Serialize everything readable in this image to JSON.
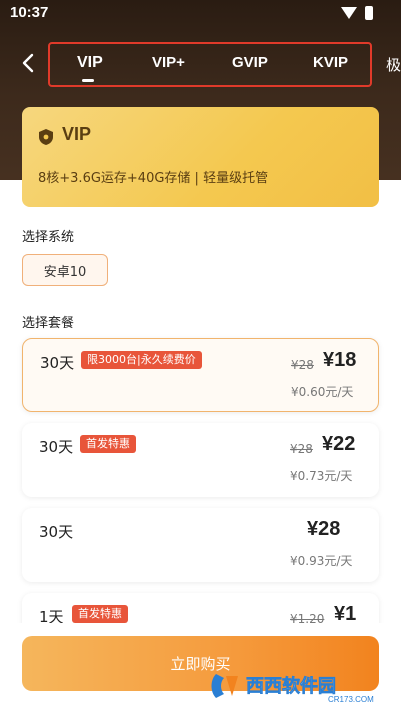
{
  "status_bar": {
    "time": "10:37"
  },
  "tabs": [
    {
      "label": "VIP",
      "active": true
    },
    {
      "label": "VIP+"
    },
    {
      "label": "GVIP"
    },
    {
      "label": "KVIP"
    },
    {
      "label": "极"
    }
  ],
  "vip_card": {
    "title": "VIP",
    "description": "8核+3.6G运存+40G存储 | 轻量级托管"
  },
  "system_section": {
    "label": "选择系统",
    "option": "安卓10"
  },
  "plan_section": {
    "label": "选择套餐"
  },
  "plans": [
    {
      "duration": "30天",
      "badge": "限3000台|永久续费价",
      "original_price": "¥28",
      "price": "¥18",
      "daily": "¥0.60元/天",
      "selected": true
    },
    {
      "duration": "30天",
      "badge": "首发特惠",
      "original_price": "¥28",
      "price": "¥22",
      "daily": "¥0.73元/天"
    },
    {
      "duration": "30天",
      "price": "¥28",
      "daily": "¥0.93元/天"
    },
    {
      "duration": "1天",
      "badge": "首发特惠",
      "original_price": "¥1.20",
      "price": "¥1"
    }
  ],
  "buy_button": {
    "label": "立即购买"
  },
  "colors": {
    "accent": "#f59a3c",
    "badge": "#e8553a",
    "header": "#2a1c12",
    "card": "#f4c84f",
    "highlight": "#e03a2a"
  },
  "watermark": {
    "text": "西西软件园",
    "subtext": "CR173.COM"
  }
}
